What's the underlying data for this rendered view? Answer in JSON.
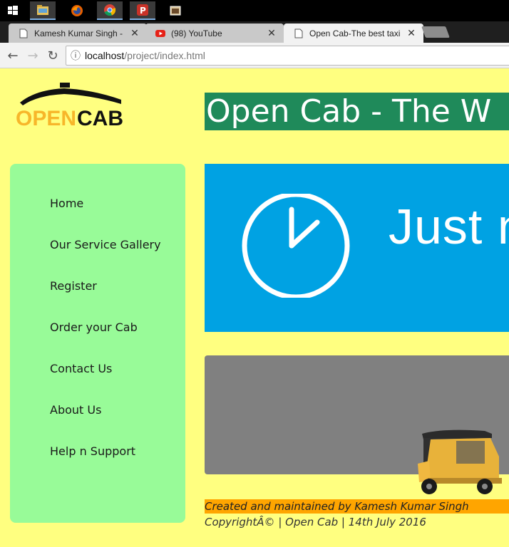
{
  "browser": {
    "tabs": [
      {
        "title": "Kamesh Kumar Singh - C",
        "close": "✕"
      },
      {
        "title": "(98) YouTube",
        "close": "✕"
      },
      {
        "title": "Open Cab-The best taxi s",
        "close": "✕"
      }
    ],
    "address": {
      "host": "localhost",
      "path": "/project/index.html"
    },
    "nav": {
      "back": "←",
      "forward": "→",
      "reload": "↻",
      "info": "ⓘ"
    }
  },
  "site": {
    "logo": {
      "open": "OPEN",
      "cab": "CAB"
    },
    "banner": "Open Cab - The W",
    "menu": [
      {
        "label": "Home"
      },
      {
        "label": "Our Service Gallery"
      },
      {
        "label": "Register"
      },
      {
        "label": "Order your Cab"
      },
      {
        "label": "Contact Us"
      },
      {
        "label": "About Us"
      },
      {
        "label": "Help n Support"
      }
    ],
    "slide_text": "Just n",
    "credit": "Created and maintained by Kamesh Kumar Singh",
    "copyright": "CopyrightÂ© | Open Cab | 14th July 2016"
  },
  "colors": {
    "page_bg": "#ffff80",
    "sidebar_bg": "#98fb98",
    "banner_bg": "#1f8a5a",
    "slide_bg": "#00a2e3",
    "gallery_bg": "#808080",
    "credit_bg": "#ffa500",
    "logo_yellow": "#f7b62a"
  }
}
